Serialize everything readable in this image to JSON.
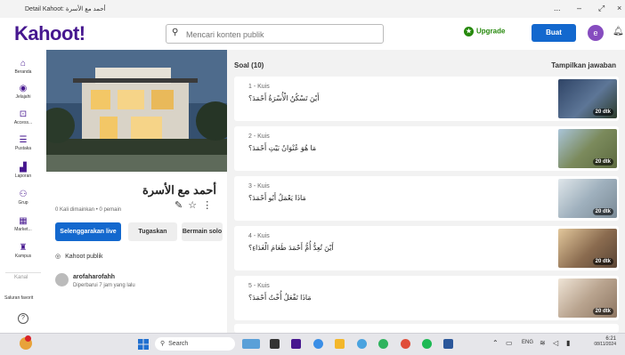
{
  "window": {
    "title": "Detail Kahoot: أحمد مع الأسرة",
    "controls": [
      "...",
      "–",
      "⤢",
      "×"
    ]
  },
  "header": {
    "logo": "Kahoot!",
    "search_placeholder": "Mencari konten publik",
    "upgrade": "Upgrade",
    "create": "Buat",
    "avatar_initial": "e"
  },
  "nav": [
    {
      "icon": "home-icon",
      "glyph": "⌂",
      "label": "Beranda"
    },
    {
      "icon": "compass-icon",
      "glyph": "◉",
      "label": "Jelajahi"
    },
    {
      "icon": "access-icon",
      "glyph": "⊡",
      "label": "Access..."
    },
    {
      "icon": "library-icon",
      "glyph": "☰",
      "label": "Pustaka"
    },
    {
      "icon": "reports-icon",
      "glyph": "▟",
      "label": "Laporan"
    },
    {
      "icon": "groups-icon",
      "glyph": "⚇",
      "label": "Grup"
    },
    {
      "icon": "market-icon",
      "glyph": "▦",
      "label": "Market..."
    },
    {
      "icon": "campus-icon",
      "glyph": "♜",
      "label": "Kampus"
    }
  ],
  "nav_bottom": {
    "channel": "Kanal",
    "favorites": "Saluran favorit",
    "help_glyph": "?"
  },
  "kahoot": {
    "title": "أحمد مع الأسرة",
    "meta": "0 Kali dimainkan • 0 pemain",
    "host_button": "Selenggarakan live",
    "assign_button": "Tugaskan",
    "solo_button": "Bermain solo",
    "visibility": "Kahoot publik",
    "author_name": "arofaharofahh",
    "author_time": "Diperbarui 7 jam yang lalu"
  },
  "questions_header": "Soal (10)",
  "show_answers": "Tampilkan jawaban",
  "questions": [
    {
      "num": "1 - Kuis",
      "text": "أَيْنَ تَسْكُنُ الْأُسْرَةُ أَحْمَدَ؟",
      "duration": "20 dtk",
      "thumb": "#3d4f66"
    },
    {
      "num": "2 - Kuis",
      "text": "مَا هُوَ عُنْوَانُ بَيْتِ أَحْمَدَ؟",
      "duration": "20 dtk",
      "thumb": "#6b7a5a"
    },
    {
      "num": "3 - Kuis",
      "text": "مَاذَا يَعْمَلُ أَبُو أَحْمَدَ؟",
      "duration": "20 dtk",
      "thumb": "#9fb0bd"
    },
    {
      "num": "4 - Kuis",
      "text": "أَيْنَ تُعِدُّ أُمُّ أَحْمَدَ طَعَامَ الْغَدَاءِ؟",
      "duration": "20 dtk",
      "thumb": "#8a6b4f"
    },
    {
      "num": "5 - Kuis",
      "text": "مَاذَا تَفْعَلُ أُخْتُ أَحْمَدَ؟",
      "duration": "20 dtk",
      "thumb": "#b9a48f"
    }
  ],
  "taskbar": {
    "search": "Search",
    "lang": "ENG",
    "time": "6:21",
    "date": "08/11/2024"
  }
}
